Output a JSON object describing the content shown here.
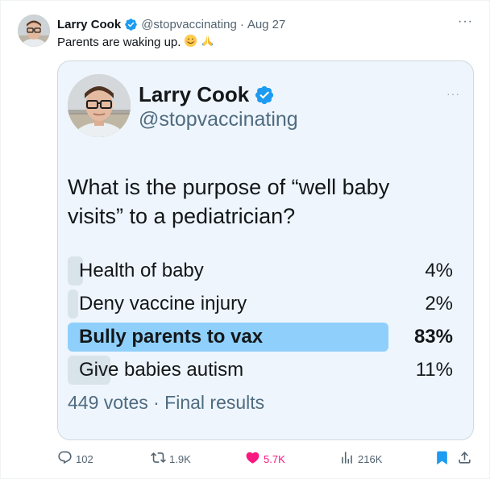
{
  "tweet": {
    "author_name": "Larry Cook",
    "handle": "@stopvaccinating",
    "separator": "·",
    "date": "Aug 27",
    "more": "···",
    "text": "Parents are waking up.",
    "emojis": [
      "smiling-face-icon",
      "folded-hands-icon"
    ]
  },
  "embedded_post": {
    "author_name": "Larry Cook",
    "handle": "@stopvaccinating",
    "more": "···",
    "question": "What is the purpose of “well baby visits” to a pediatrician?",
    "poll": {
      "options": [
        {
          "label": "Health of baby",
          "percent_text": "4%",
          "percent": 4,
          "winner": false
        },
        {
          "label": "Deny vaccine injury",
          "percent_text": "2%",
          "percent": 2,
          "winner": false
        },
        {
          "label": "Bully parents to vax",
          "percent_text": "83%",
          "percent": 83,
          "winner": true
        },
        {
          "label": "Give babies autism",
          "percent_text": "11%",
          "percent": 11,
          "winner": false
        }
      ],
      "footer": "449 votes · Final results"
    }
  },
  "actions": {
    "replies": "102",
    "retweets": "1.9K",
    "likes": "5.7K",
    "views": "216K"
  },
  "colors": {
    "verified": "#1d9bf0",
    "like": "#f91880",
    "poll_winner": "#8ed0fb",
    "poll_bar": "#d9e3ea",
    "card_bg": "#eef5fc"
  }
}
